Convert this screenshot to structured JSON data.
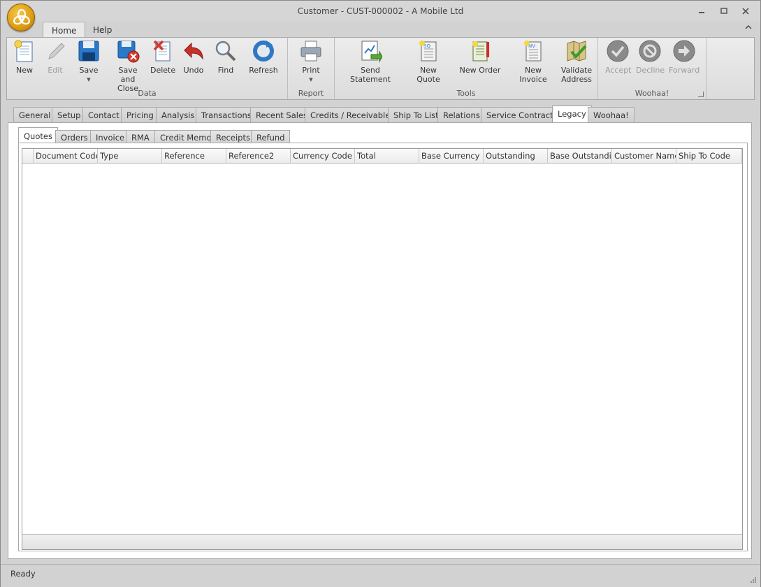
{
  "window": {
    "title": "Customer - CUST-000002 - A Mobile Ltd",
    "minimize_icon": "minimize-icon",
    "restore_icon": "restore-icon",
    "close_icon": "close-icon"
  },
  "ribbon_tabs": [
    {
      "label": "Home",
      "active": true
    },
    {
      "label": "Help",
      "active": false
    }
  ],
  "ribbon": {
    "groups": {
      "data": "Data",
      "report": "Report",
      "tools": "Tools",
      "woohaa": "Woohaa!"
    },
    "buttons": {
      "new": "New",
      "edit": "Edit",
      "save": "Save",
      "save_close_1": "Save and",
      "save_close_2": "Close",
      "delete": "Delete",
      "undo": "Undo",
      "find": "Find",
      "refresh": "Refresh",
      "print": "Print",
      "send_statement": "Send Statement",
      "new_quote": "New Quote",
      "new_order": "New Order",
      "new_invoice": "New Invoice",
      "validate_1": "Validate",
      "validate_2": "Address",
      "accept": "Accept",
      "decline": "Decline",
      "forward": "Forward"
    }
  },
  "main_tabs": [
    "General",
    "Setup",
    "Contact",
    "Pricing",
    "Analysis",
    "Transactions",
    "Recent Sales",
    "Credits / Receivables",
    "Ship To List",
    "Relations",
    "Service Contracts",
    "Legacy",
    "Woohaa!"
  ],
  "main_tab_active": "Legacy",
  "sub_tabs": [
    "Quotes",
    "Orders",
    "Invoice",
    "RMA",
    "Credit Memo",
    "Receipts",
    "Refund"
  ],
  "sub_tab_active": "Quotes",
  "grid": {
    "columns": [
      "Document Code",
      "Type",
      "Reference",
      "Reference2",
      "Currency Code",
      "Total",
      "Base Currency ...",
      "Outstanding",
      "Base Outstandi...",
      "Customer Name",
      "Ship To Code"
    ],
    "rows": []
  },
  "status": {
    "text": "Ready"
  }
}
